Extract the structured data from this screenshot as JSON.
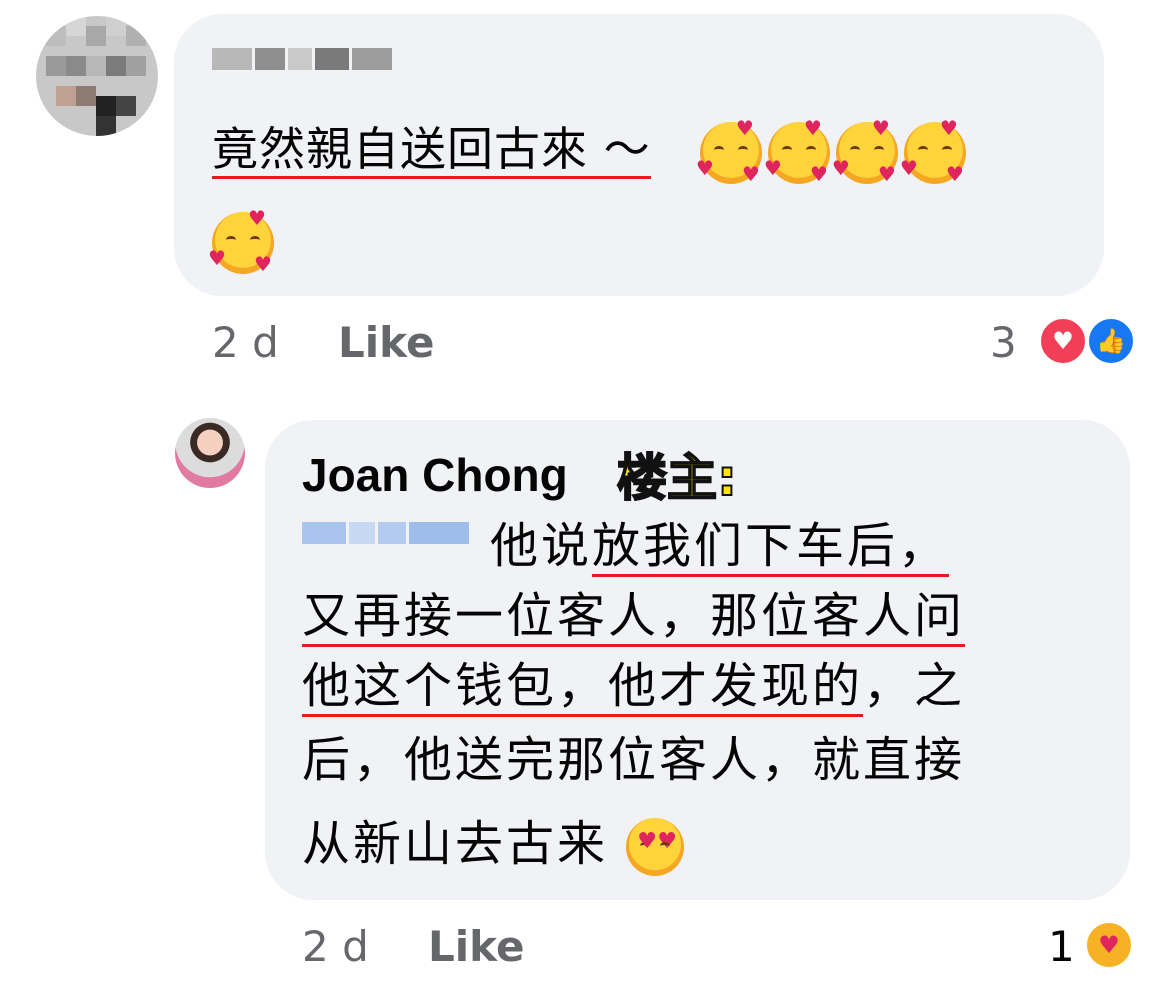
{
  "comment1": {
    "text_underlined": "竟然親自送回古來 ～",
    "age": "2 d",
    "like_label": "Like",
    "reaction_count": "3",
    "reactions": [
      "heart-reaction-icon",
      "like-reaction-icon"
    ]
  },
  "comment2": {
    "author": "Joan Chong",
    "tag": "楼主:",
    "line1_plain": "他说",
    "line1_underlined": "放我们下车后，",
    "line2": "又再接一位客人，那位客人问",
    "line3_underlined": "他这个钱包，他才发现的",
    "line3_plain": "，之",
    "line4": "后，他送完那位客人，就直接",
    "line5": "从新山去古来",
    "age": "2 d",
    "like_label": "Like",
    "reaction_count": "1",
    "reactions": [
      "care-reaction-icon"
    ]
  },
  "colors": {
    "bubble": "#f0f2f5",
    "underline": "#e41c1c",
    "meta": "#65676b",
    "tag_fill": "#ffe400"
  }
}
